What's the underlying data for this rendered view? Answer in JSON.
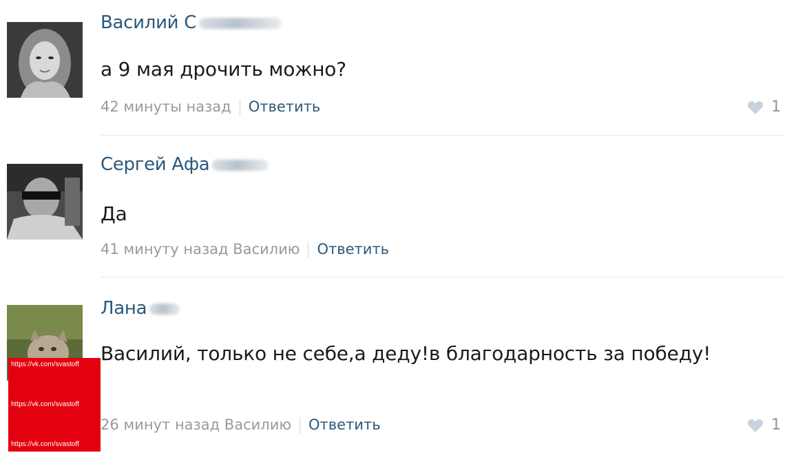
{
  "comments": [
    {
      "author": "Василий С",
      "text": "а 9 мая дрочить можно?",
      "time": "42 минуты назад",
      "reply_to": "",
      "reply_label": "Ответить",
      "likes": "1"
    },
    {
      "author": "Сергей Афа",
      "text": "Да",
      "time": "41 минуту назад",
      "reply_to": "Василию",
      "reply_label": "Ответить",
      "likes": ""
    },
    {
      "author": "Лана",
      "text": "Василий, только не себе,а деду!в благодарность за победу!",
      "time": "26 минут назад",
      "reply_to": "Василию",
      "reply_label": "Ответить",
      "likes": "1"
    }
  ],
  "watermark": {
    "text": "https://vk.com/svastoff"
  },
  "colors": {
    "link": "#2b587a",
    "meta": "#999999",
    "watermark_bg": "#e3000f"
  }
}
